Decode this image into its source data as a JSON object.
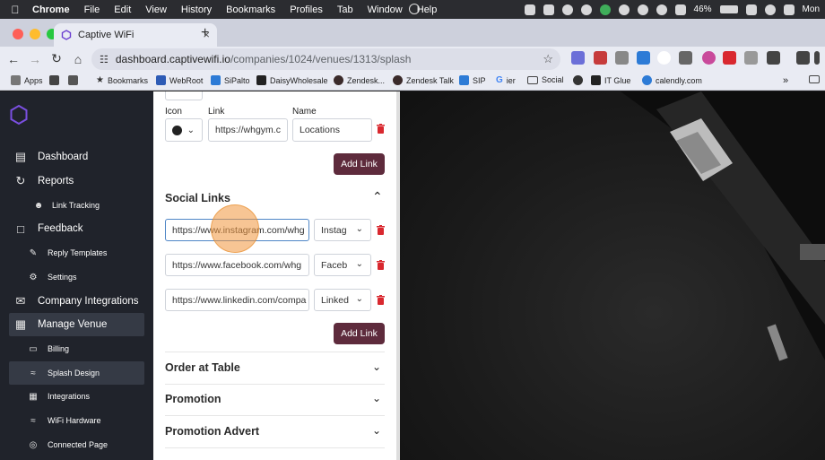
{
  "menubar": {
    "app": "Chrome",
    "items": [
      "File",
      "Edit",
      "View",
      "History",
      "Bookmarks",
      "Profiles",
      "Tab",
      "Window",
      "Help"
    ],
    "battery": "46%",
    "clock": "Mon"
  },
  "tab": {
    "title": "Captive WiFi"
  },
  "address": {
    "domain": "dashboard.captivewifi.io",
    "path": "/companies/1024/venues/1313/splash"
  },
  "bookmarks": [
    {
      "label": "Apps"
    },
    {
      "label": "Bookmarks"
    },
    {
      "label": "WebRoot"
    },
    {
      "label": "SiPalto"
    },
    {
      "label": "DaisyWholesale"
    },
    {
      "label": "Zendesk..."
    },
    {
      "label": "Zendesk Talk"
    },
    {
      "label": "SIP"
    },
    {
      "label": "ier"
    },
    {
      "label": "Social"
    },
    {
      "label": "IT Glue"
    },
    {
      "label": "calendly.com"
    }
  ],
  "sidebar": {
    "items": [
      {
        "label": "Dashboard",
        "icon": "dashboard-icon"
      },
      {
        "label": "Reports",
        "icon": "refresh-icon"
      },
      {
        "label": "Link Tracking",
        "icon": "users-icon"
      },
      {
        "label": "Feedback",
        "icon": "chat-icon"
      },
      {
        "label": "Reply Templates",
        "icon": "edit-icon"
      },
      {
        "label": "Settings",
        "icon": "gear-icon"
      },
      {
        "label": "Company Integrations",
        "icon": "mail-icon"
      },
      {
        "label": "Manage Venue",
        "icon": "store-icon"
      },
      {
        "label": "Billing",
        "icon": "card-icon"
      },
      {
        "label": "Splash Design",
        "icon": "wifi-icon"
      },
      {
        "label": "Integrations",
        "icon": "grid-icon"
      },
      {
        "label": "WiFi Hardware",
        "icon": "wifi-icon"
      },
      {
        "label": "Connected Page",
        "icon": "globe-icon"
      }
    ]
  },
  "links_form": {
    "icon_label": "Icon",
    "link_label": "Link",
    "name_label": "Name",
    "link_value": "https://whgym.c",
    "name_value": "Locations",
    "add_button": "Add Link"
  },
  "social_links": {
    "title": "Social Links",
    "rows": [
      {
        "url": "https://www.instagram.com/whg",
        "network": "Instag"
      },
      {
        "url": "https://www.facebook.com/whg",
        "network": "Faceb"
      },
      {
        "url": "https://www.linkedin.com/compa",
        "network": "Linked"
      }
    ],
    "add_button": "Add Link"
  },
  "sections": [
    {
      "title": "Order at Table"
    },
    {
      "title": "Promotion"
    },
    {
      "title": "Promotion Advert"
    }
  ],
  "colors": {
    "sidebar": "#20232b",
    "accent_button": "#5e2b3c",
    "trash": "#d9282f"
  }
}
